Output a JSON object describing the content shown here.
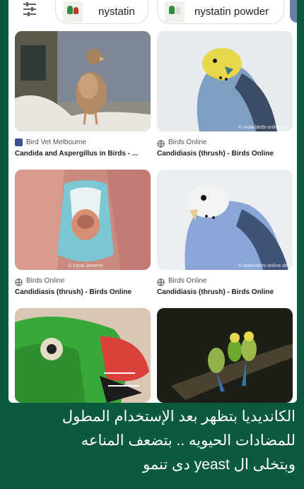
{
  "chips": [
    {
      "label": "nystatin",
      "icon": "medicine-thumbnail"
    },
    {
      "label": "nystatin powder",
      "icon": "medicine-thumbnail"
    }
  ],
  "results": [
    {
      "source": "Bird Vet Melbourne",
      "source_icon": "site-favicon",
      "title": "Candida and Aspergillus in Birds - ..."
    },
    {
      "source": "Birds Online",
      "source_icon": "globe-icon",
      "title": "Candidiasis (thrush) - Birds Online",
      "watermark": "© www.birds-online.de"
    },
    {
      "source": "Birds Online",
      "source_icon": "globe-icon",
      "title": "Candidiasis (thrush) - Birds Online",
      "watermark": "© Lena Jemene"
    },
    {
      "source": "Birds Online",
      "source_icon": "globe-icon",
      "title": "Candidiasis (thrush) - Birds Online",
      "watermark": "© www.birds-online.de"
    },
    {
      "source": "",
      "title": ""
    },
    {
      "source": "",
      "title": ""
    }
  ],
  "caption": {
    "line1": "الكانديديا بتظهر بعد الإستخدام المطول",
    "line2": "للمضادات الحيويه .. بتضعف المناعه",
    "line3": "وبتخلى ال yeast دى تنمو"
  },
  "colors": {
    "background": "#0b5a3e",
    "card_title": "#202124",
    "source_text": "#4d5156"
  }
}
